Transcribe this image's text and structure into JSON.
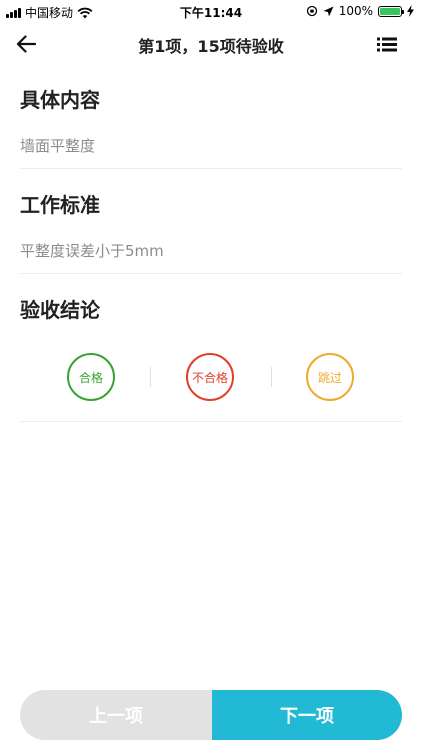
{
  "status_bar": {
    "carrier": "中国移动",
    "time": "下午11:44",
    "battery_percent": "100%",
    "battery_level": 1.0,
    "battery_color": "#35c759"
  },
  "nav": {
    "back_icon": "arrow-left-icon",
    "title": "第1项，15项待验收",
    "list_icon": "list-icon"
  },
  "detail": {
    "content_label": "具体内容",
    "content_value": "墙面平整度",
    "standard_label": "工作标准",
    "standard_value": "平整度误差小于5mm",
    "conclusion_label": "验收结论"
  },
  "conclusion_options": [
    {
      "label": "合格",
      "color": "#3aa335"
    },
    {
      "label": "不合格",
      "color": "#e0402a"
    },
    {
      "label": "跳过",
      "color": "#f0a930"
    }
  ],
  "actions": {
    "prev_label": "上一项",
    "next_label": "下一项",
    "next_color": "#22b9d4",
    "prev_color": "#e2e2e2"
  }
}
